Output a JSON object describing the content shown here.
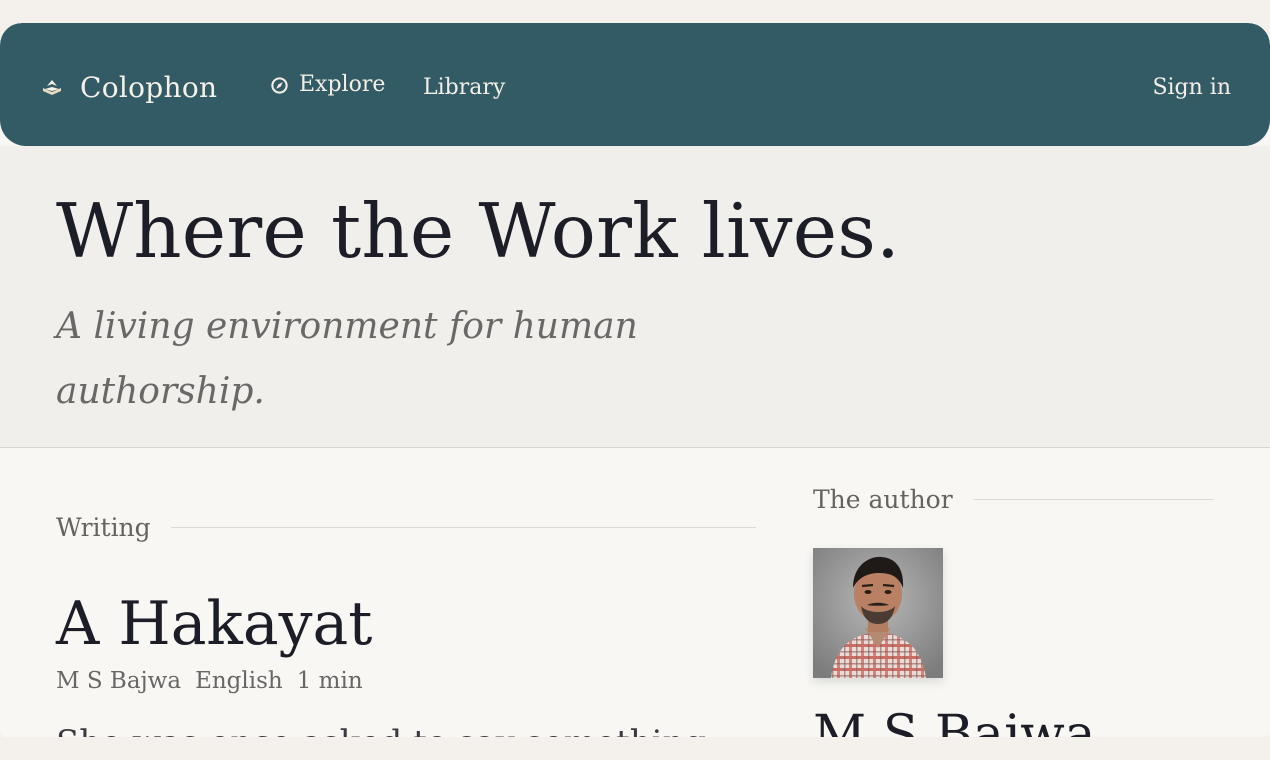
{
  "nav": {
    "brand": "Colophon",
    "explore": "Explore",
    "library": "Library",
    "sign_in": "Sign in"
  },
  "hero": {
    "title": "Where the Work lives.",
    "subtitle": "A living environment for human authorship."
  },
  "writing": {
    "heading": "Writing",
    "title": "A Hakayat",
    "author": "M S Bajwa",
    "language": "English",
    "read_time": "1 min",
    "excerpt": "She was once asked to say something"
  },
  "author_panel": {
    "heading": "The author",
    "name": "M S Bajwa"
  },
  "icons": {
    "brand": "book-icon",
    "explore": "compass-icon"
  },
  "colors": {
    "navbar": "#335b66",
    "hero_bg": "#f0efeb",
    "page_bg": "#f8f7f4",
    "title_text": "#1c1d26"
  }
}
